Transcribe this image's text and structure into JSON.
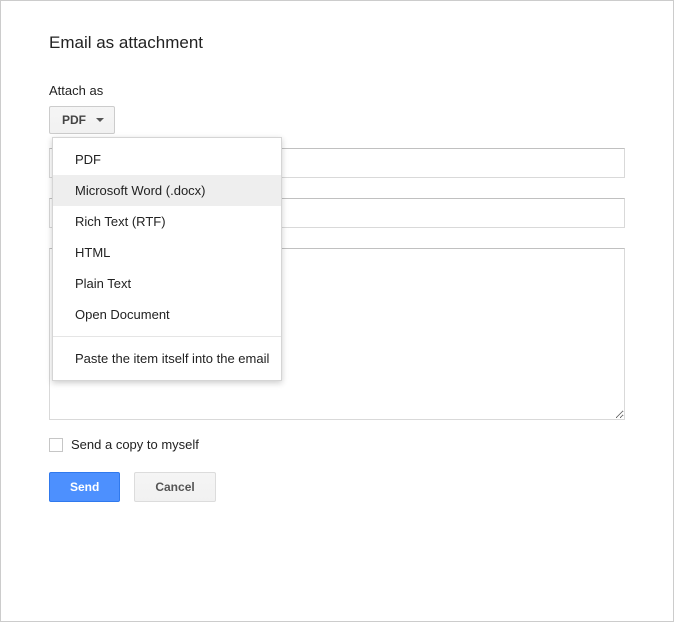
{
  "modal": {
    "title": "Email as attachment",
    "attach_label": "Attach as",
    "dropdown_selected": "PDF",
    "checkbox_label": "Send a copy to myself",
    "send_label": "Send",
    "cancel_label": "Cancel"
  },
  "dropdown": {
    "options": [
      "PDF",
      "Microsoft Word (.docx)",
      "Rich Text (RTF)",
      "HTML",
      "Plain Text",
      "Open Document"
    ],
    "footer_option": "Paste the item itself into the email",
    "hover_index": 1
  }
}
